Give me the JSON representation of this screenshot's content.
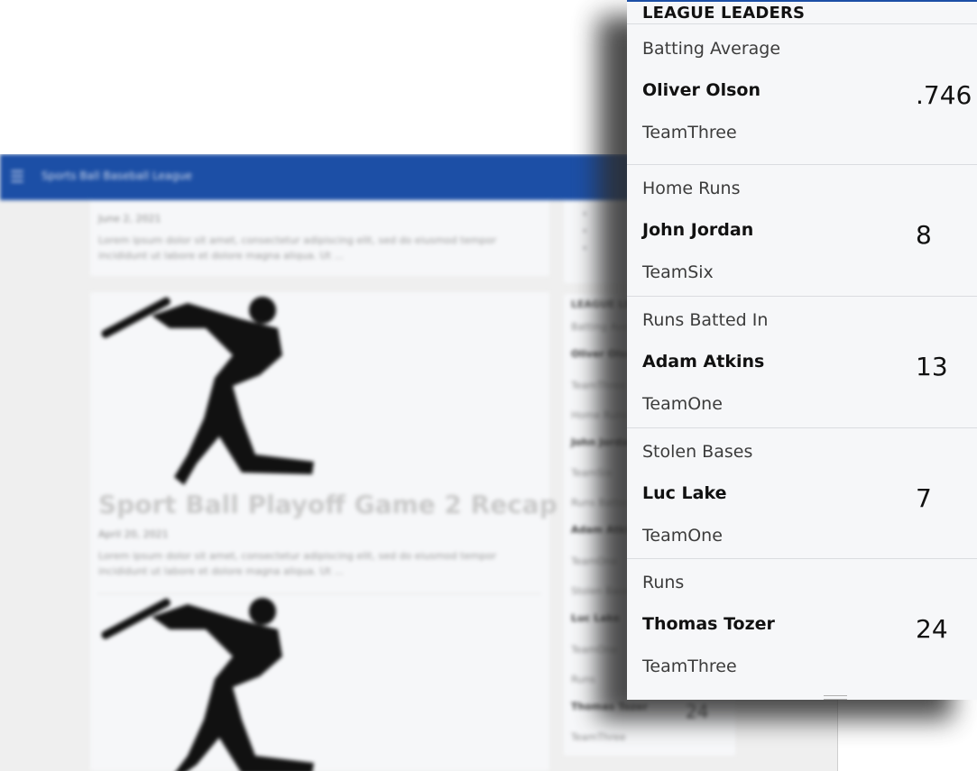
{
  "background_app": {
    "title": "Sports Ball Baseball League",
    "menu_icon": "hamburger-icon",
    "top_post": {
      "date": "June 2, 2021",
      "excerpt": "Lorem ipsum dolor sit amet, consectetur adipiscing elit, sed do eiusmod tempor incididunt ut labore et dolore magna aliqua. Ut ..."
    },
    "main_post": {
      "title": "Sport Ball Playoff Game 2 Recap",
      "date": "April 20, 2021",
      "excerpt": "Lorem ipsum dolor sit amet, consectetur adipiscing elit, sed do eiusmod tempor incididunt ut labore et dolore magna aliqua. Ut ..."
    },
    "sidebar_leaders": {
      "title": "LEAGUE LEADERS",
      "rows": [
        "Batting Average",
        "Oliver Olson",
        "TeamThree",
        "Home Runs",
        "John Jordan",
        "TeamSix",
        "Runs Batted In",
        "Adam Atkins",
        "TeamOne",
        "Stolen Bases",
        "Luc Lake",
        "TeamOne",
        "Runs",
        "Thomas Tozer",
        "TeamThree"
      ],
      "last_value": "24"
    }
  },
  "leaders_panel": {
    "title": "LEAGUE LEADERS",
    "accent_color": "#1c4fa6",
    "sections": [
      {
        "stat": "Batting Average",
        "player": "Oliver Olson",
        "team": "TeamThree",
        "value": ".746"
      },
      {
        "stat": "Home Runs",
        "player": "John Jordan",
        "team": "TeamSix",
        "value": "8"
      },
      {
        "stat": "Runs Batted In",
        "player": "Adam Atkins",
        "team": "TeamOne",
        "value": "13"
      },
      {
        "stat": "Stolen Bases",
        "player": "Luc Lake",
        "team": "TeamOne",
        "value": "7"
      },
      {
        "stat": "Runs",
        "player": "Thomas Tozer",
        "team": "TeamThree",
        "value": "24"
      }
    ]
  }
}
